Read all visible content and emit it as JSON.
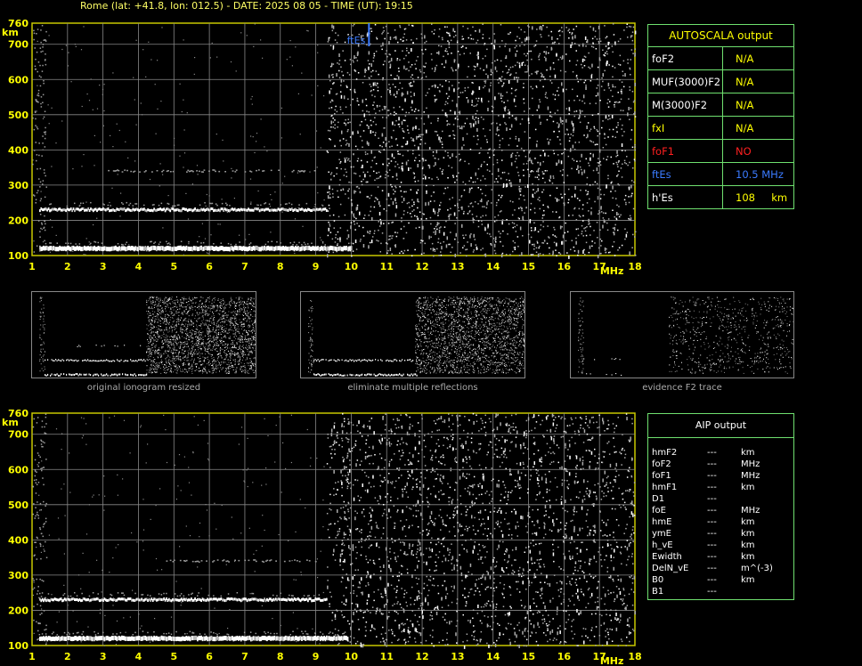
{
  "header": "Rome (lat: +41.8, lon: 012.5) - DATE: 2025 08 05 - TIME (UT): 19:15",
  "colors": {
    "grid": "#888888",
    "frame": "#c8c800",
    "tick_text": "#ffff00",
    "table_border": "#6fe06f",
    "es_marker": "#3b7bff"
  },
  "chart_data": [
    {
      "type": "scatter",
      "name": "autoscala-ionogram",
      "xlabel": "MHz",
      "ylabel": "km",
      "xlim": [
        1,
        18
      ],
      "ylim": [
        100,
        760
      ],
      "x_ticks": [
        "1",
        "2",
        "3",
        "4",
        "5",
        "6",
        "7",
        "8",
        "9",
        "10",
        "11",
        "12",
        "13",
        "14",
        "15",
        "16",
        "17",
        "18"
      ],
      "y_ticks": [
        "100",
        "200",
        "300",
        "400",
        "500",
        "600",
        "700",
        "760"
      ],
      "grid": true,
      "traces": [
        {
          "desc": "E/Es trace",
          "x_range": [
            1.2,
            10.0
          ],
          "height": 120
        },
        {
          "desc": "2x multiple reflection",
          "x_range": [
            1.2,
            9.3
          ],
          "height": 230
        },
        {
          "desc": "3x multiple reflection",
          "x_range": [
            3.0,
            9.0
          ],
          "height": 340
        }
      ],
      "marker": {
        "label": "ftEs",
        "x": 10.5
      }
    },
    {
      "type": "scatter",
      "name": "aip-ionogram",
      "xlabel": "MHz",
      "ylabel": "km",
      "xlim": [
        1,
        18
      ],
      "ylim": [
        100,
        760
      ],
      "x_ticks": [
        "1",
        "2",
        "3",
        "4",
        "5",
        "6",
        "7",
        "8",
        "9",
        "10",
        "11",
        "12",
        "13",
        "14",
        "15",
        "16",
        "17",
        "18"
      ],
      "y_ticks": [
        "100",
        "200",
        "300",
        "400",
        "500",
        "600",
        "700",
        "760"
      ],
      "grid": true,
      "traces": [
        {
          "desc": "E/Es trace",
          "x_range": [
            1.2,
            9.9
          ],
          "height": 120
        },
        {
          "desc": "2x multiple reflection",
          "x_range": [
            1.2,
            9.3
          ],
          "height": 230
        },
        {
          "desc": "3x multiple reflection",
          "x_range": [
            4.5,
            9.0
          ],
          "height": 340
        }
      ]
    }
  ],
  "autoscala": {
    "title": "AUTOSCALA output",
    "rows": [
      {
        "key": "foF2",
        "value": "N/A",
        "key_color": "#ffffff",
        "val_color": "#ffff00"
      },
      {
        "key": "MUF(3000)F2",
        "value": "N/A",
        "key_color": "#ffffff",
        "val_color": "#ffff00"
      },
      {
        "key": "M(3000)F2",
        "value": "N/A",
        "key_color": "#ffffff",
        "val_color": "#ffff00"
      },
      {
        "key": "fxI",
        "value": "N/A",
        "key_color": "#ffff00",
        "val_color": "#ffff00"
      },
      {
        "key": "foF1",
        "value": "NO",
        "key_color": "#ff2020",
        "val_color": "#ff2020"
      },
      {
        "key": "ftEs",
        "value": "10.5 MHz",
        "key_color": "#3b7bff",
        "val_color": "#3b7bff"
      },
      {
        "key": "h'Es",
        "value": "108     km",
        "key_color": "#ffffff",
        "val_color": "#ffff00"
      }
    ]
  },
  "thumbnails": [
    {
      "caption": "original ionogram resized"
    },
    {
      "caption": "eliminate multiple reflections"
    },
    {
      "caption": "evidence F2 trace"
    }
  ],
  "aip": {
    "title": "AIP output",
    "rows": [
      {
        "key": "hmF2",
        "value": "---",
        "unit": "km"
      },
      {
        "key": "foF2",
        "value": "---",
        "unit": "MHz"
      },
      {
        "key": "foF1",
        "value": "---",
        "unit": "MHz"
      },
      {
        "key": "hmF1",
        "value": "---",
        "unit": "km"
      },
      {
        "key": "D1",
        "value": "---",
        "unit": ""
      },
      {
        "key": "foE",
        "value": "---",
        "unit": "MHz"
      },
      {
        "key": "hmE",
        "value": "---",
        "unit": "km"
      },
      {
        "key": "ymE",
        "value": "---",
        "unit": "km"
      },
      {
        "key": "h_vE",
        "value": "---",
        "unit": "km"
      },
      {
        "key": "Ewidth",
        "value": "---",
        "unit": "km"
      },
      {
        "key": "DelN_vE",
        "value": "---",
        "unit": "m^(-3)"
      },
      {
        "key": "B0",
        "value": "---",
        "unit": "km"
      },
      {
        "key": "B1",
        "value": "---",
        "unit": ""
      }
    ]
  }
}
